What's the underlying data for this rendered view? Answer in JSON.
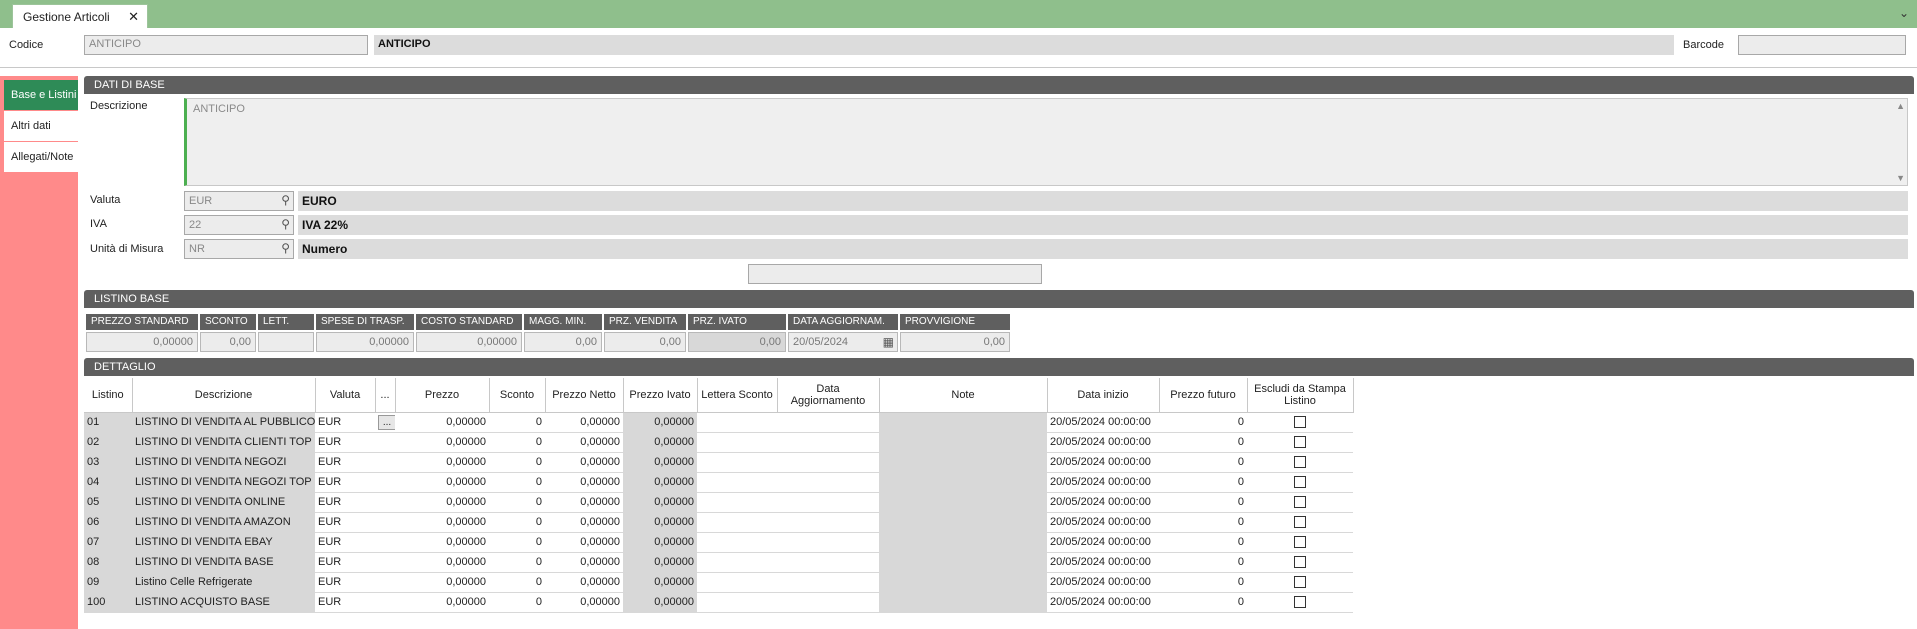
{
  "window": {
    "tab_title": "Gestione Articoli",
    "close_glyph": "✕",
    "menu_glyph": "⌄"
  },
  "header": {
    "codice_label": "Codice",
    "codice_value": "ANTICIPO",
    "codice_desc": "ANTICIPO",
    "barcode_label": "Barcode",
    "barcode_value": ""
  },
  "side_tabs": [
    {
      "label": "Base e Listini",
      "active": true
    },
    {
      "label": "Altri dati",
      "active": false
    },
    {
      "label": "Allegati/Note",
      "active": false
    }
  ],
  "dati_base": {
    "section_title": "DATI DI BASE",
    "descrizione_label": "Descrizione",
    "descrizione_value": "ANTICIPO",
    "valuta_label": "Valuta",
    "valuta_code": "EUR",
    "valuta_desc": "EURO",
    "iva_label": "IVA",
    "iva_code": "22",
    "iva_desc": "IVA 22%",
    "um_label": "Unità di Misura",
    "um_code": "NR",
    "um_desc": "Numero"
  },
  "listino_base": {
    "section_title": "LISTINO BASE",
    "headers": [
      "PREZZO STANDARD",
      "SCONTO",
      "LETT.",
      "SPESE DI TRASP.",
      "COSTO STANDARD",
      "MAGG. MIN.",
      "PRZ. VENDITA",
      "PRZ. IVATO",
      "DATA AGGIORNAM.",
      "PROVVIGIONE"
    ],
    "values": [
      "0,00000",
      "0,00",
      "",
      "0,00000",
      "0,00000",
      "0,00",
      "0,00",
      "0,00",
      "20/05/2024",
      "0,00"
    ]
  },
  "dettaglio": {
    "section_title": "DETTAGLIO",
    "columns": [
      "Listino",
      "Descrizione",
      "Valuta",
      "...",
      "Prezzo",
      "Sconto",
      "Prezzo Netto",
      "Prezzo Ivato",
      "Lettera Sconto",
      "Data Aggiornamento",
      "Note",
      "Data inizio",
      "Prezzo futuro",
      "Escludi da Stampa Listino"
    ],
    "rows": [
      {
        "listino": "01",
        "descrizione": "LISTINO DI VENDITA AL PUBBLICO",
        "valuta": "EUR",
        "prezzo": "0,00000",
        "sconto": "0",
        "netto": "0,00000",
        "ivato": "0,00000",
        "lettera": "",
        "data_agg": "",
        "note": "",
        "data_inizio": "20/05/2024 00:00:00",
        "futuro": "0"
      },
      {
        "listino": "02",
        "descrizione": "LISTINO DI VENDITA CLIENTI TOP",
        "valuta": "EUR",
        "prezzo": "0,00000",
        "sconto": "0",
        "netto": "0,00000",
        "ivato": "0,00000",
        "lettera": "",
        "data_agg": "",
        "note": "",
        "data_inizio": "20/05/2024 00:00:00",
        "futuro": "0"
      },
      {
        "listino": "03",
        "descrizione": "LISTINO DI VENDITA NEGOZI",
        "valuta": "EUR",
        "prezzo": "0,00000",
        "sconto": "0",
        "netto": "0,00000",
        "ivato": "0,00000",
        "lettera": "",
        "data_agg": "",
        "note": "",
        "data_inizio": "20/05/2024 00:00:00",
        "futuro": "0"
      },
      {
        "listino": "04",
        "descrizione": "LISTINO DI VENDITA NEGOZI TOP",
        "valuta": "EUR",
        "prezzo": "0,00000",
        "sconto": "0",
        "netto": "0,00000",
        "ivato": "0,00000",
        "lettera": "",
        "data_agg": "",
        "note": "",
        "data_inizio": "20/05/2024 00:00:00",
        "futuro": "0"
      },
      {
        "listino": "05",
        "descrizione": "LISTINO DI VENDITA ONLINE",
        "valuta": "EUR",
        "prezzo": "0,00000",
        "sconto": "0",
        "netto": "0,00000",
        "ivato": "0,00000",
        "lettera": "",
        "data_agg": "",
        "note": "",
        "data_inizio": "20/05/2024 00:00:00",
        "futuro": "0"
      },
      {
        "listino": "06",
        "descrizione": "LISTINO DI VENDITA AMAZON",
        "valuta": "EUR",
        "prezzo": "0,00000",
        "sconto": "0",
        "netto": "0,00000",
        "ivato": "0,00000",
        "lettera": "",
        "data_agg": "",
        "note": "",
        "data_inizio": "20/05/2024 00:00:00",
        "futuro": "0"
      },
      {
        "listino": "07",
        "descrizione": "LISTINO DI VENDITA EBAY",
        "valuta": "EUR",
        "prezzo": "0,00000",
        "sconto": "0",
        "netto": "0,00000",
        "ivato": "0,00000",
        "lettera": "",
        "data_agg": "",
        "note": "",
        "data_inizio": "20/05/2024 00:00:00",
        "futuro": "0"
      },
      {
        "listino": "08",
        "descrizione": "LISTINO DI VENDITA BASE",
        "valuta": "EUR",
        "prezzo": "0,00000",
        "sconto": "0",
        "netto": "0,00000",
        "ivato": "0,00000",
        "lettera": "",
        "data_agg": "",
        "note": "",
        "data_inizio": "20/05/2024 00:00:00",
        "futuro": "0"
      },
      {
        "listino": "09",
        "descrizione": "Listino Celle Refrigerate",
        "valuta": "EUR",
        "prezzo": "0,00000",
        "sconto": "0",
        "netto": "0,00000",
        "ivato": "0,00000",
        "lettera": "",
        "data_agg": "",
        "note": "",
        "data_inizio": "20/05/2024 00:00:00",
        "futuro": "0"
      },
      {
        "listino": "100",
        "descrizione": "LISTINO ACQUISTO BASE",
        "valuta": "EUR",
        "prezzo": "0,00000",
        "sconto": "0",
        "netto": "0,00000",
        "ivato": "0,00000",
        "lettera": "",
        "data_agg": "",
        "note": "",
        "data_inizio": "20/05/2024 00:00:00",
        "futuro": "0"
      }
    ],
    "first_row_button": "..."
  },
  "colors": {
    "tab_bar": "#8fbf8c",
    "active_side_tab": "#2e8b57",
    "side_panel": "#ff8a8a",
    "section_header": "#5f5f5f"
  }
}
